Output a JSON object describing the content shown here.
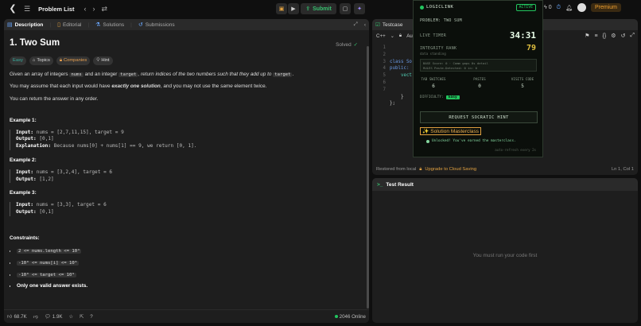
{
  "topnav": {
    "problem_list": "Problem List",
    "submit": "Submit",
    "streak": "0",
    "premium": "Premium"
  },
  "left": {
    "tabs": [
      "Description",
      "Editorial",
      "Solutions",
      "Submissions"
    ],
    "title": "1. Two Sum",
    "solved": "Solved",
    "chips": [
      "Easy",
      "Topics",
      "Companies",
      "Hint"
    ],
    "p1_pre": "Given an array of integers ",
    "p1_c1": "nums",
    "p1_mid": " and an integer ",
    "p1_c2": "target",
    "p1_italic": ", return indices of the two numbers such that they add up to ",
    "p1_c3": "target",
    "p1_end": ".",
    "p2_pre": "You may assume that each input would have ",
    "p2_bold": "exactly one solution",
    "p2_mid": ", and you may not use the ",
    "p2_italic": "same",
    "p2_end": " element twice.",
    "p3": "You can return the answer in any order.",
    "ex1_title": "Example 1:",
    "ex1_input": "nums = [2,7,11,15], target = 9",
    "ex1_output": "[0,1]",
    "ex1_expl": "Because nums[0] + nums[1] == 9, we return [0, 1].",
    "ex2_title": "Example 2:",
    "ex2_input": "nums = [3,2,4], target = 6",
    "ex2_output": "[1,2]",
    "ex3_title": "Example 3:",
    "ex3_input": "nums = [3,3], target = 6",
    "ex3_output": "[0,1]",
    "input_label": "Input:",
    "output_label": "Output:",
    "expl_label": "Explanation:",
    "constraints_title": "Constraints:",
    "constraints": [
      "2 <= nums.length <= 10⁴",
      "-10⁹ <= nums[i] <= 10⁹",
      "-10⁹ <= target <= 10⁹",
      "Only one valid answer exists."
    ],
    "likes": "68.7K",
    "comments": "1.9K",
    "online": "2046 Online"
  },
  "right": {
    "tab": "Testcase",
    "lang": "C++",
    "auto": "Au",
    "code_lines": [
      "class So",
      "public:",
      "    vect",
      "",
      "",
      "    }",
      "};"
    ],
    "line_numbers": [
      "1",
      "2",
      "3",
      "4",
      "5",
      "6",
      "7"
    ],
    "restored": "Restored from local",
    "upgrade": "Upgrade to Cloud Saving",
    "cursor": "Ln 1, Col 1"
  },
  "result": {
    "title": "Test Result",
    "empty": "You must run your code first"
  },
  "overlay": {
    "brand": "LOGICLINK",
    "status": "ACTIVE",
    "problem": "PROBLEM: TWO SUM",
    "live_label": "LIVE TIMER",
    "timer": "34:31",
    "integrity_label": "INTEGRITY RANK",
    "integrity_sub": "data standing",
    "rank": "79",
    "log1": "BASE   Score: 0 · Comm gaps 0s detail",
    "log2": "RULES  Paste-Detected: 0 in: 0",
    "stats": [
      {
        "label": "TAB SWITCHES",
        "value": "6"
      },
      {
        "label": "PASTES",
        "value": "0"
      },
      {
        "label": "VISITS CODE",
        "value": "5"
      }
    ],
    "difficulty_label": "DIFFICULTY:",
    "difficulty": "Easy",
    "hint_button": "REQUEST SOCRATIC HINT",
    "masterclass": "Solution Masterclass",
    "unlocked": "Unlocked! You've earned the masterclass.",
    "session": "auto-refresh every 2s"
  }
}
